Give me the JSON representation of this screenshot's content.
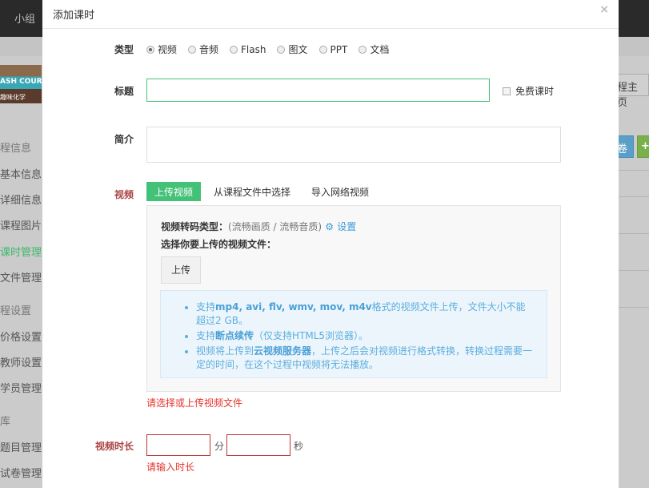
{
  "topbar": {
    "nav_item": "小组"
  },
  "course_thumb": {
    "text": "ASH COURSE",
    "caption": "趣味化学"
  },
  "sidebar": {
    "sections": [
      {
        "title": "程信息",
        "items": [
          "基本信息",
          "详细信息",
          "课程图片",
          "课时管理",
          "文件管理"
        ]
      },
      {
        "title": "程设置",
        "items": [
          "价格设置",
          "教师设置",
          "学员管理"
        ]
      },
      {
        "title": "库",
        "items": [
          "题目管理",
          "试卷管理"
        ]
      }
    ],
    "active": "课时管理"
  },
  "right_buttons": {
    "home": "程主页",
    "paper": "卷",
    "add": "+"
  },
  "colors": {
    "accent": "#43c177",
    "error": "#e5332a",
    "info": "#5aaedd",
    "link": "#3a9ad9"
  },
  "modal": {
    "title": "添加课时",
    "close": "×",
    "type_label": "类型",
    "types": [
      {
        "label": "视频",
        "checked": true
      },
      {
        "label": "音频",
        "checked": false
      },
      {
        "label": "Flash",
        "checked": false
      },
      {
        "label": "图文",
        "checked": false
      },
      {
        "label": "PPT",
        "checked": false
      },
      {
        "label": "文档",
        "checked": false
      }
    ],
    "title_label": "标题",
    "title_value": "",
    "free_label": "免费课时",
    "summary_label": "简介",
    "summary_value": "",
    "video_label": "视频",
    "video_tabs": [
      "上传视频",
      "从课程文件中选择",
      "导入网络视频"
    ],
    "transcode_label": "视频转码类型：",
    "transcode_value": "(流畅画质 / 流畅音质)",
    "settings_link": "设置",
    "choose_label": "选择你要上传的视频文件：",
    "upload_button": "上传",
    "tips": [
      {
        "pre": "支持",
        "bold": "mp4, avi, flv, wmv, mov, m4v",
        "post": "格式的视频文件上传，文件大小不能超过2 GB。"
      },
      {
        "pre": "支持",
        "bold": "断点续传",
        "post": "（仅支持HTML5浏览器）。"
      },
      {
        "pre": "视频将上传到",
        "bold": "云视频服务器",
        "post": "，上传之后会对视频进行格式转换，转换过程需要一定的时间，在这个过程中视频将无法播放。"
      }
    ],
    "video_error": "请选择或上传视频文件",
    "duration_label": "视频时长",
    "minutes_value": "",
    "minutes_unit": "分",
    "seconds_value": "",
    "seconds_unit": "秒",
    "duration_error": "请输入时长"
  }
}
